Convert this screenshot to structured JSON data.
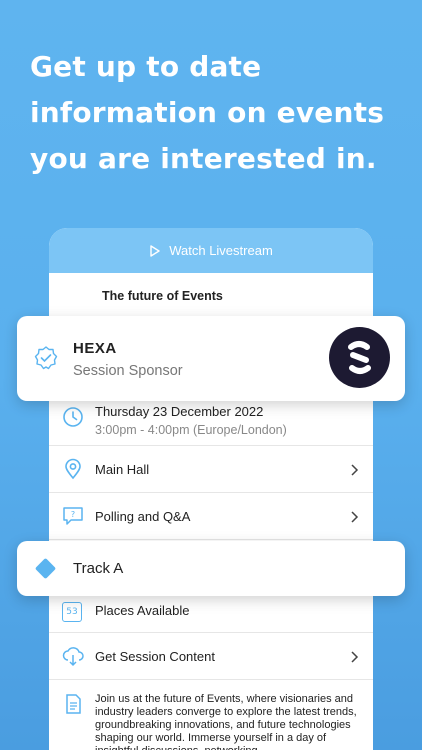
{
  "headline": "Get up to date information on events you are interested in.",
  "livestream": {
    "label": "Watch Livestream"
  },
  "session": {
    "title": "The future of Events"
  },
  "sponsor": {
    "name": "HEXA",
    "role": "Session Sponsor"
  },
  "date": {
    "day": "Thursday 23 December 2022",
    "time": "3:00pm - 4:00pm (Europe/London)"
  },
  "location": {
    "label": "Main Hall"
  },
  "polling": {
    "label": "Polling and Q&A"
  },
  "track": {
    "label": "Track A"
  },
  "places": {
    "count": "53",
    "label": "Places Available"
  },
  "content": {
    "label": "Get Session Content"
  },
  "description": "Join us at the future of Events, where visionaries and industry leaders converge to explore the latest trends, groundbreaking innovations, and future technologies shaping our world. Immerse yourself in a day of insightful discussions, networking",
  "colors": {
    "accent": "#5ab4f0",
    "background": "#5fb4ef",
    "livestream_bar": "#7cc5f5"
  }
}
